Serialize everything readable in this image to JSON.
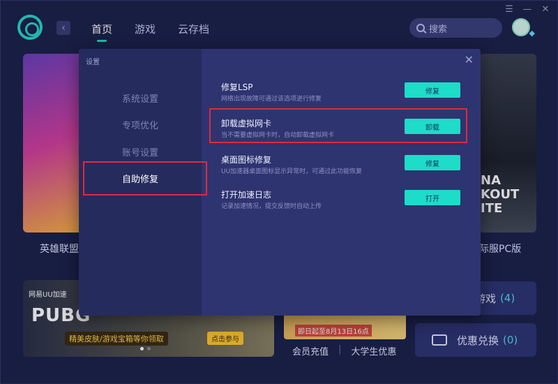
{
  "window": {
    "controls": [
      "☰",
      "—",
      "✕"
    ]
  },
  "nav": {
    "back": "‹",
    "tabs": [
      "首页",
      "游戏",
      "云存档"
    ]
  },
  "search": {
    "placeholder": "搜索"
  },
  "background": {
    "left_game_label": "英雄联盟",
    "right_game_label": "际服PC版",
    "right_card_text": "NA\nKOUT\nITE",
    "banner": {
      "brand": "网易UU加速",
      "headline": "PUBG",
      "sub": "精美皮肤/游戏宝箱等你领取",
      "cta": "点击参与"
    },
    "promo": {
      "date": "即日起至8月13日16点"
    },
    "promo_links": [
      "会员充值",
      "大学生优惠"
    ],
    "side_buttons": [
      {
        "label": "游戏",
        "count": "(4)"
      },
      {
        "label": "优惠兑换",
        "count": "(0)"
      }
    ]
  },
  "dialog": {
    "title": "设置",
    "close": "✕",
    "menu": [
      "系统设置",
      "专项优化",
      "账号设置",
      "自助修复"
    ],
    "active_menu": "自助修复",
    "items": [
      {
        "title": "修复LSP",
        "desc": "网络出现故障可通过该选项进行修复",
        "button": "修复"
      },
      {
        "title": "卸载虚拟网卡",
        "desc": "当不需要虚拟网卡时，自动卸载虚拟网卡",
        "button": "卸载"
      },
      {
        "title": "桌面图标修复",
        "desc": "UU加速器桌面图标显示异常时，可通过此功能恢复",
        "button": "修复"
      },
      {
        "title": "打开加速日志",
        "desc": "记录加速情况，提交反馈时自动上传",
        "button": "打开"
      }
    ]
  }
}
